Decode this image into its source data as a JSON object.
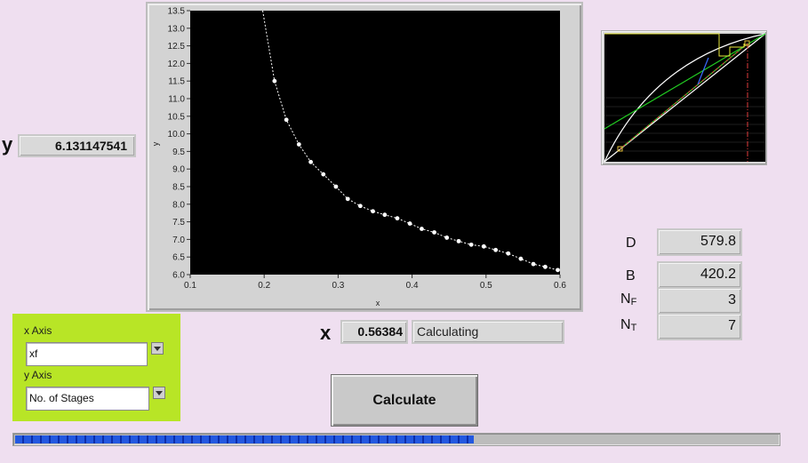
{
  "y_readout": {
    "label": "y",
    "value": "6.131147541"
  },
  "x_readout": {
    "label": "x",
    "value": "0.56384"
  },
  "status": {
    "text": "Calculating"
  },
  "axis_selector": {
    "x_label": "x Axis",
    "x_value": "xf",
    "y_label": "y Axis",
    "y_value": "No. of Stages"
  },
  "calculate_button": {
    "label": "Calculate"
  },
  "progress": {
    "fraction": 0.6
  },
  "results": [
    {
      "name": "D",
      "sub": "",
      "value": "579.8"
    },
    {
      "name": "B",
      "sub": "",
      "value": "420.2"
    },
    {
      "name": "N",
      "sub": "F",
      "value": "3"
    },
    {
      "name": "N",
      "sub": "T",
      "value": "7"
    }
  ],
  "colors": {
    "background": "#efdff0",
    "panel_green": "#b8e526",
    "plot_bg": "#000000",
    "series": "#ffffff",
    "progress_fill": "#2358e0"
  },
  "chart_data": {
    "type": "scatter",
    "xlabel": "x",
    "ylabel": "y",
    "xlim": [
      0.1,
      0.6
    ],
    "ylim": [
      6.0,
      13.5
    ],
    "x_ticks": [
      "0.1",
      "0.2",
      "0.3",
      "0.4",
      "0.5",
      "0.6"
    ],
    "y_ticks": [
      "6.0",
      "6.5",
      "7.0",
      "7.5",
      "8.0",
      "8.5",
      "9.0",
      "9.5",
      "10.0",
      "10.5",
      "11.0",
      "11.5",
      "12.0",
      "12.5",
      "13.0",
      "13.5"
    ],
    "grid": false,
    "series": [
      {
        "points": [
          [
            0.198,
            13.5
          ],
          [
            0.214,
            11.5
          ],
          [
            0.23,
            10.4
          ],
          [
            0.247,
            9.7
          ],
          [
            0.263,
            9.2
          ],
          [
            0.28,
            8.85
          ],
          [
            0.297,
            8.5
          ],
          [
            0.313,
            8.15
          ],
          [
            0.33,
            7.95
          ],
          [
            0.347,
            7.8
          ],
          [
            0.363,
            7.7
          ],
          [
            0.38,
            7.6
          ],
          [
            0.397,
            7.45
          ],
          [
            0.413,
            7.3
          ],
          [
            0.43,
            7.2
          ],
          [
            0.447,
            7.05
          ],
          [
            0.463,
            6.95
          ],
          [
            0.48,
            6.85
          ],
          [
            0.497,
            6.8
          ],
          [
            0.513,
            6.7
          ],
          [
            0.53,
            6.6
          ],
          [
            0.547,
            6.45
          ],
          [
            0.564,
            6.3
          ],
          [
            0.58,
            6.22
          ],
          [
            0.597,
            6.13
          ]
        ]
      }
    ]
  },
  "mini_chart": {
    "type": "mccabe-thiele",
    "note_free": true
  }
}
